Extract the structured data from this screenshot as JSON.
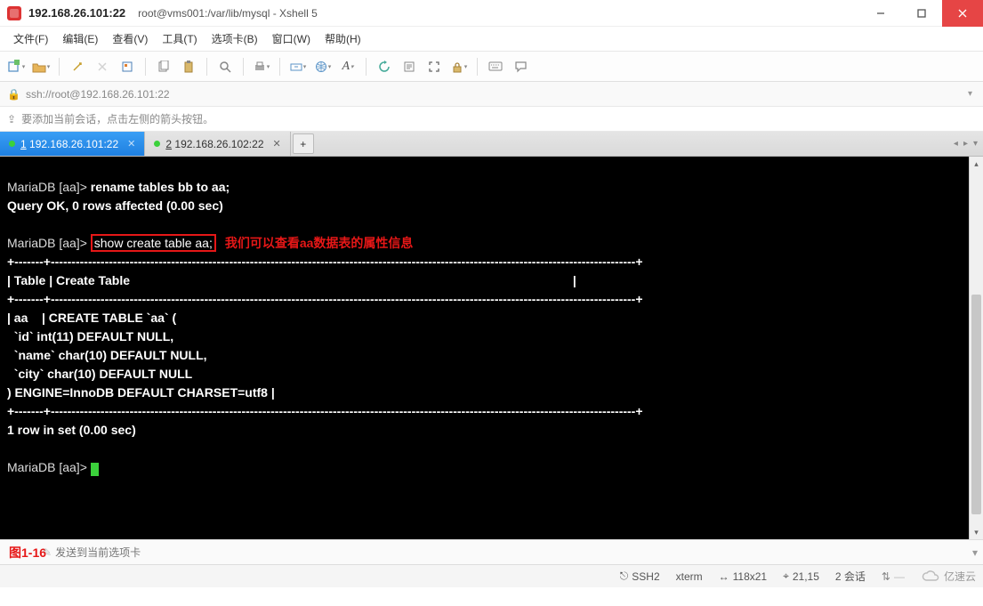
{
  "titlebar": {
    "ip_title": "192.168.26.101:22",
    "subtitle": "root@vms001:/var/lib/mysql - Xshell 5"
  },
  "menu": {
    "file": "文件(F)",
    "edit": "编辑(E)",
    "view": "查看(V)",
    "tools": "工具(T)",
    "tabs": "选项卡(B)",
    "window": "窗口(W)",
    "help": "帮助(H)"
  },
  "addressbar": {
    "url": "ssh://root@192.168.26.101:22"
  },
  "hint": {
    "text": "要添加当前会话，点击左侧的箭头按钮。"
  },
  "tabs": {
    "t1_idx": "1",
    "t1_label": "192.168.26.101:22",
    "t2_idx": "2",
    "t2_label": "192.168.26.102:22",
    "add": "+"
  },
  "terminal": {
    "l1a": "MariaDB [aa]> ",
    "l1b": "rename tables bb to aa;",
    "l2": "Query OK, 0 rows affected (0.00 sec)",
    "l3": "",
    "l4a": "MariaDB [aa]> ",
    "l4b": "show create table aa;",
    "l4c": "我们可以查看aa数据表的属性信息",
    "l5": "+-------+---------------------------------------------------------------------------------------------------------------------------------------------+",
    "l6": "| Table | Create Table                                                                                                                                |",
    "l7": "+-------+---------------------------------------------------------------------------------------------------------------------------------------------+",
    "l8": "| aa    | CREATE TABLE `aa` (",
    "l9": "  `id` int(11) DEFAULT NULL,",
    "l10": "  `name` char(10) DEFAULT NULL,",
    "l11": "  `city` char(10) DEFAULT NULL",
    "l12": ") ENGINE=InnoDB DEFAULT CHARSET=utf8 |",
    "l13": "+-------+---------------------------------------------------------------------------------------------------------------------------------------------+",
    "l14": "1 row in set (0.00 sec)",
    "l15": "",
    "l16": "MariaDB [aa]> "
  },
  "compose": {
    "figlabel": "图1-16",
    "placeholder": "发送到当前选项卡"
  },
  "status": {
    "proto": "SSH2",
    "term": "xterm",
    "size": "118x21",
    "pos": "21,15",
    "sessions": "2 会话"
  },
  "brand": {
    "text": "亿速云"
  }
}
